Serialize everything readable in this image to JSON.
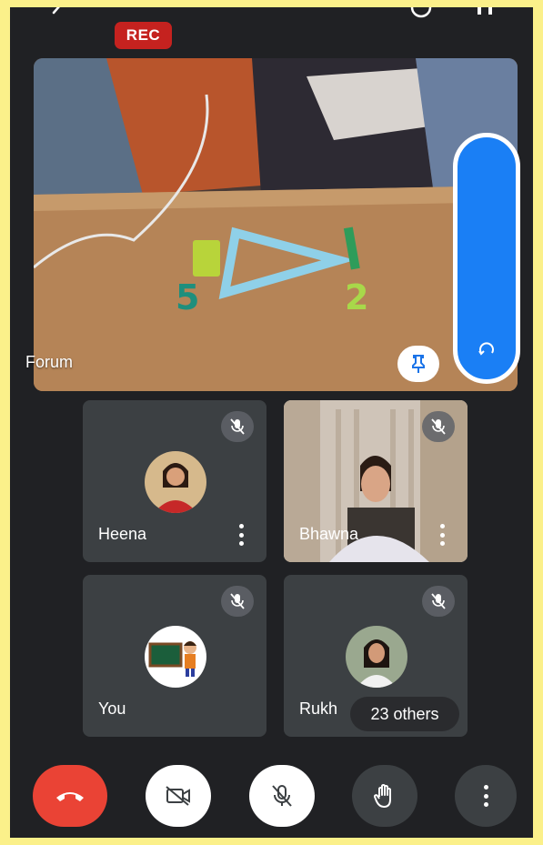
{
  "status": {
    "recording_label": "REC"
  },
  "main_video": {
    "label": "Forum",
    "scene_digits": [
      "5",
      "2"
    ]
  },
  "participants": [
    {
      "name": "Heena",
      "muted": true
    },
    {
      "name": "Bhawna",
      "muted": true
    },
    {
      "name": "You",
      "muted": true
    },
    {
      "name": "Rukh",
      "muted": true
    }
  ],
  "others": {
    "label": "23 others"
  },
  "controls": {
    "end_call": "end-call",
    "camera": "camera-off",
    "microphone": "mic-off",
    "raise_hand": "raise-hand",
    "more": "more-options"
  },
  "colors": {
    "background": "#202124",
    "tile": "#3c4043",
    "end_call": "#ea4335",
    "rec": "#c5221f",
    "side_panel": "#1a7ff5",
    "frame": "#fbf08a"
  }
}
